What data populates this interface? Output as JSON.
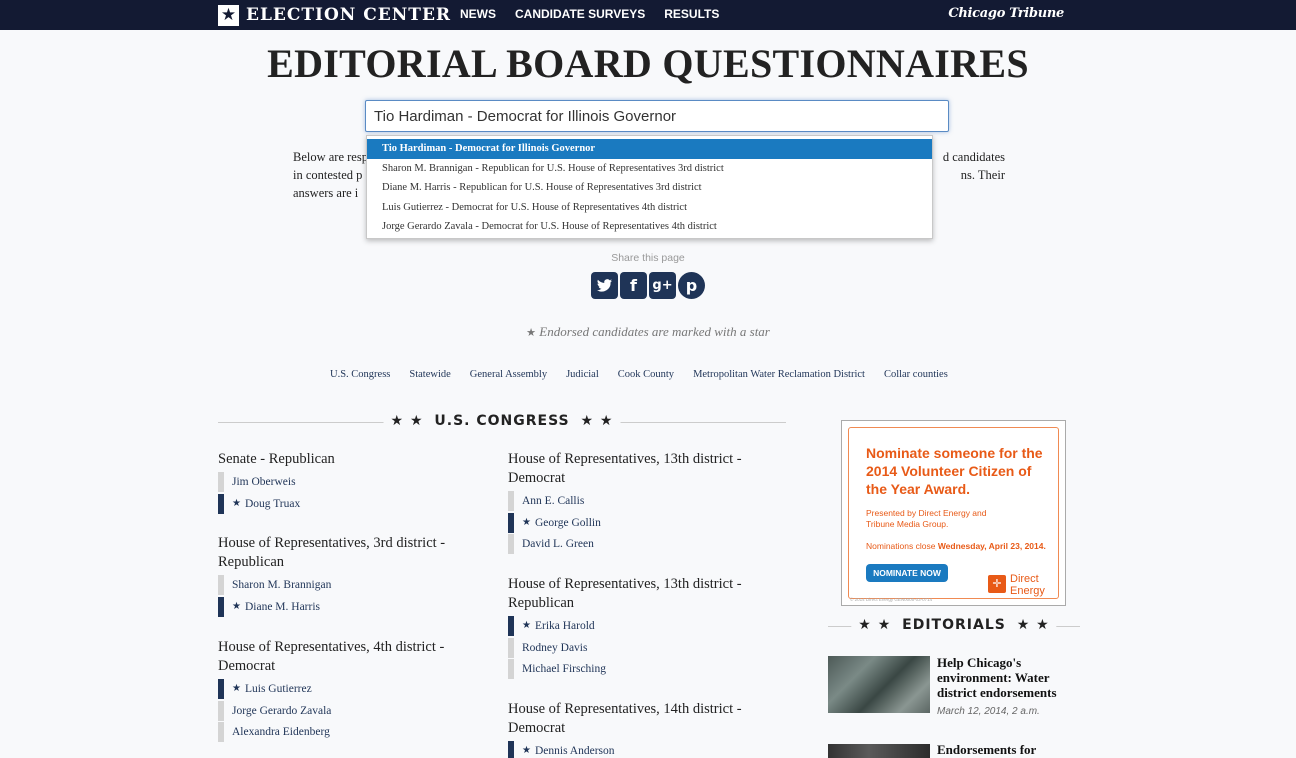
{
  "header": {
    "brand": "ELECTION CENTER",
    "nav": [
      "NEWS",
      "CANDIDATE SURVEYS",
      "RESULTS"
    ],
    "partner": "Chicago Tribune"
  },
  "page_title": "EDITORIAL BOARD QUESTIONNAIRES",
  "search": {
    "value": "Tio Hardiman - Democrat for Illinois Governor"
  },
  "autocomplete": [
    "Tio Hardiman - Democrat for Illinois Governor",
    "Sharon M. Brannigan - Republican for U.S. House of Representatives 3rd district",
    "Diane M. Harris - Republican for U.S. House of Representatives 3rd district",
    "Luis Gutierrez - Democrat for U.S. House of Representatives 4th district",
    "Jorge Gerardo Zavala - Democrat for U.S. House of Representatives 4th district"
  ],
  "intro": {
    "line1_start": "Below are resp",
    "line1_end": "d candidates",
    "line2_start": "in contested p",
    "line2_end": "ns. Their",
    "line3_start": "answers are i"
  },
  "share": {
    "label": "Share this page",
    "icons": [
      "twitter-icon",
      "facebook-icon",
      "google-plus-icon",
      "pinterest-icon"
    ]
  },
  "endorse_note": "Endorsed candidates are marked with a star",
  "section_nav": [
    "U.S. Congress",
    "Statewide",
    "General Assembly",
    "Judicial",
    "Cook County",
    "Metropolitan Water Reclamation District",
    "Collar counties"
  ],
  "section": {
    "title": "U.S. CONGRESS"
  },
  "races": [
    {
      "title": "Senate - Republican",
      "candidates": [
        {
          "name": "Jim Oberweis",
          "endorsed": false
        },
        {
          "name": "Doug Truax",
          "endorsed": true
        }
      ]
    },
    {
      "title": "House of Representatives, 3rd district - Republican",
      "candidates": [
        {
          "name": "Sharon M. Brannigan",
          "endorsed": false
        },
        {
          "name": "Diane M. Harris",
          "endorsed": true
        }
      ]
    },
    {
      "title": "House of Representatives, 4th district - Democrat",
      "candidates": [
        {
          "name": "Luis Gutierrez",
          "endorsed": true
        },
        {
          "name": "Jorge Gerardo Zavala",
          "endorsed": false
        },
        {
          "name": "Alexandra Eidenberg",
          "endorsed": false
        }
      ]
    },
    {
      "title": "House of Representatives, 13th district - Democrat",
      "candidates": [
        {
          "name": "Ann E. Callis",
          "endorsed": false
        },
        {
          "name": "George Gollin",
          "endorsed": true
        },
        {
          "name": "David L. Green",
          "endorsed": false
        }
      ]
    },
    {
      "title": "House of Representatives, 13th district - Republican",
      "candidates": [
        {
          "name": "Erika Harold",
          "endorsed": true
        },
        {
          "name": "Rodney Davis",
          "endorsed": false
        },
        {
          "name": "Michael Firsching",
          "endorsed": false
        }
      ]
    },
    {
      "title": "House of Representatives, 14th district - Democrat",
      "candidates": [
        {
          "name": "Dennis Anderson",
          "endorsed": true
        }
      ]
    }
  ],
  "ad": {
    "headline": "Nominate someone for the 2014 Volunteer Citizen of the Year Award.",
    "sub": "Presented by Direct Energy and Tribune Media Group.",
    "close_prefix": "Nominations close ",
    "close_date": "Wednesday, April 23, 2014.",
    "button": "NOMINATE NOW",
    "logo": "Direct Energy",
    "fine_print": "© 2014 Direct Energy GEN0005-03-0714"
  },
  "editorials": {
    "title": "EDITORIALS",
    "items": [
      {
        "title": "Help Chicago's environment: Water district endorsements",
        "date": "March 12, 2014, 2 a.m."
      },
      {
        "title": "Endorsements for"
      }
    ]
  },
  "colors": {
    "navy": "#131a33",
    "link": "#1f3457",
    "highlight": "#1a7ac0",
    "ad_orange": "#e85a17"
  }
}
